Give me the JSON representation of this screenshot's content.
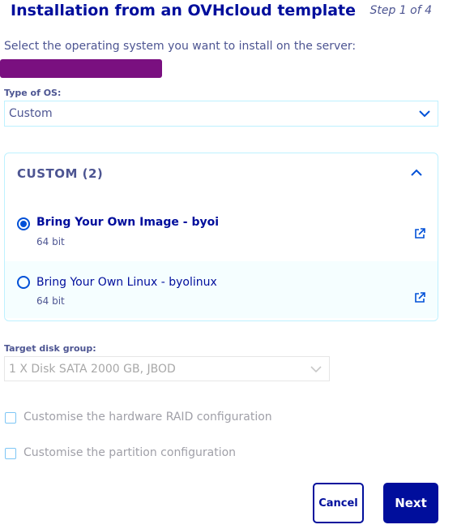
{
  "header": {
    "title": "Installation from an OVHcloud template",
    "step": "Step 1 of 4"
  },
  "intro": "Select the operating system you want to install on the server:",
  "os_type": {
    "label": "Type of OS:",
    "value": "Custom"
  },
  "custom_panel": {
    "title": "CUSTOM (2)",
    "options": [
      {
        "name": "Bring Your Own Image - byoi",
        "arch": "64 bit",
        "selected": true
      },
      {
        "name": "Bring Your Own Linux - byolinux",
        "arch": "64 bit",
        "selected": false
      }
    ]
  },
  "disk_group": {
    "label": "Target disk group:",
    "value": "1 X Disk SATA 2000 GB, JBOD"
  },
  "checkboxes": {
    "raid": "Customise the hardware RAID configuration",
    "partition": "Customise the partition configuration"
  },
  "buttons": {
    "cancel": "Cancel",
    "next": "Next"
  },
  "colors": {
    "primary": "#000e9c",
    "text": "#4d5592",
    "accent_border": "#bef1ff",
    "redaction": "#7a1080"
  }
}
